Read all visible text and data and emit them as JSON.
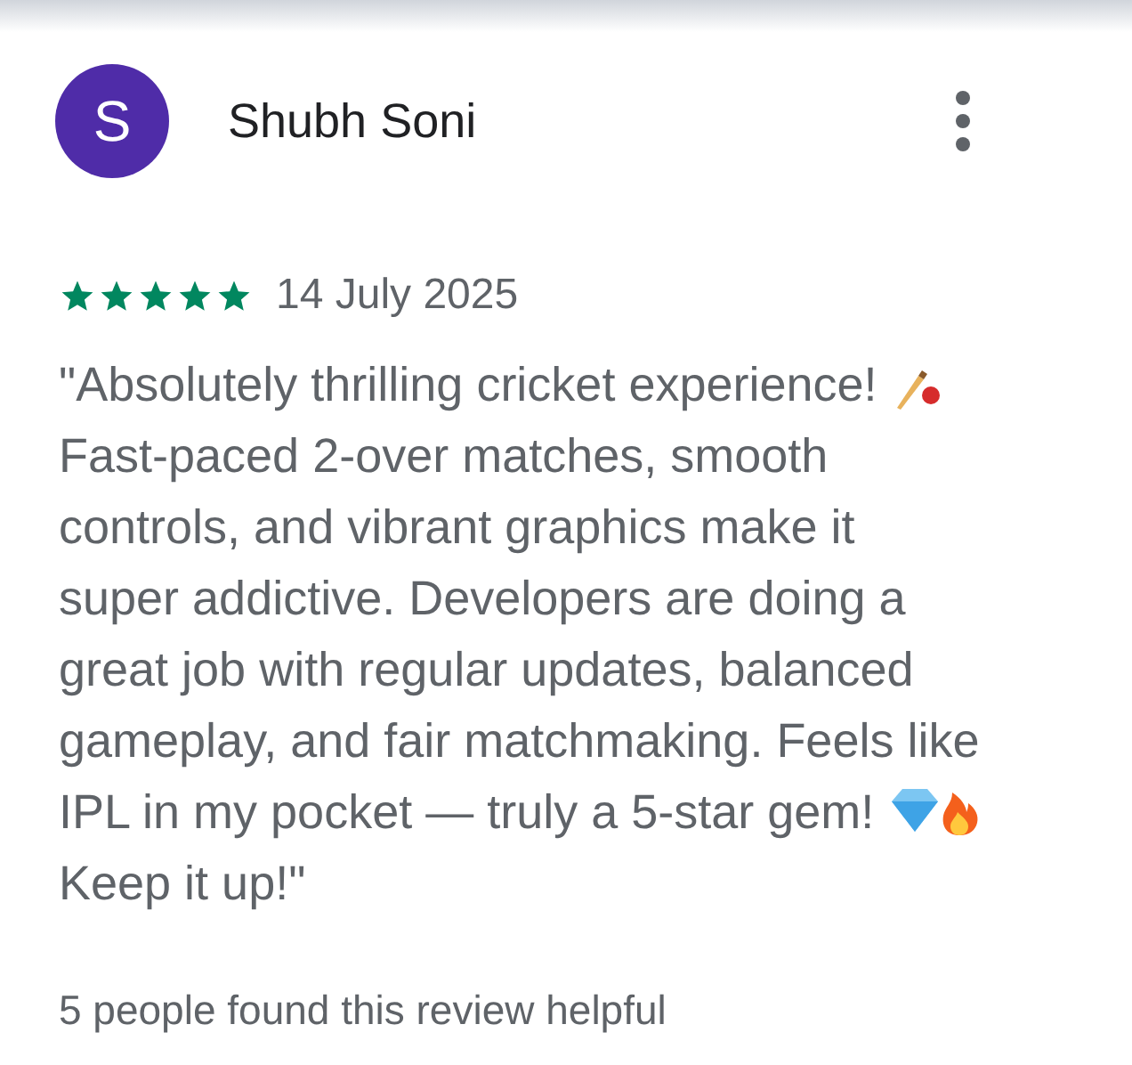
{
  "review": {
    "avatar_letter": "S",
    "author": "Shubh Soni",
    "stars": 5,
    "date": "14 July 2025",
    "lines": [
      "\"Absolutely thrilling cricket experience!",
      "Fast-paced 2-over matches, smooth",
      "controls, and vibrant graphics make it",
      "super addictive. Developers are doing a",
      "great job with regular updates, balanced",
      "gameplay, and fair matchmaking. Feels like",
      "IPL in my pocket — truly a 5-star gem!",
      "Keep it up!\""
    ],
    "helpful": "5 people found this review helpful"
  }
}
